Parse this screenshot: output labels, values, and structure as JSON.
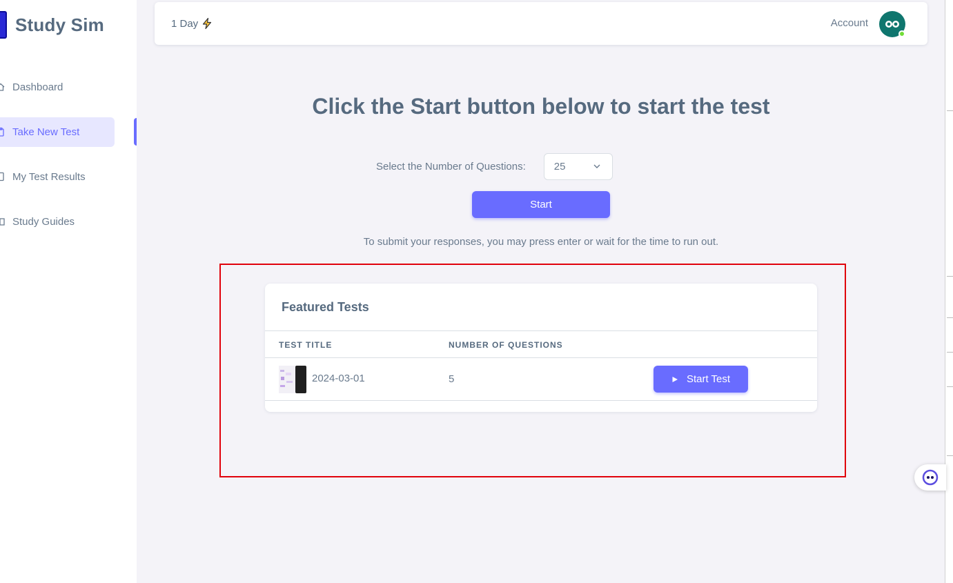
{
  "app": {
    "name": "Study Sim"
  },
  "sidebar": {
    "items": [
      {
        "label": "Dashboard",
        "icon": "home-icon"
      },
      {
        "label": "Take New Test",
        "icon": "clipboard-icon",
        "active": true
      },
      {
        "label": "My Test Results",
        "icon": "file-icon"
      },
      {
        "label": "Study Guides",
        "icon": "book-icon"
      }
    ]
  },
  "topbar": {
    "streak_label": "1 Day",
    "streak_icon": "lightning-icon",
    "account_label": "Account",
    "avatar_icon": "owl-avatar-icon"
  },
  "main": {
    "title": "Click the Start button below to start the test",
    "select_label": "Select the Number of Questions:",
    "select_value": "25",
    "start_button": "Start",
    "hint": "To submit your responses, you may press enter or wait for the time to run out."
  },
  "featured": {
    "title": "Featured Tests",
    "columns": [
      "Test Title",
      "Number of Questions"
    ],
    "rows": [
      {
        "title": "2024-03-01",
        "count": "5",
        "action": "Start Test"
      }
    ]
  },
  "colors": {
    "accent": "#696cff",
    "active_bg": "#e7e7ff",
    "highlight": "#e0000a",
    "avatar_bg": "#0f766e",
    "online": "#71dd37"
  }
}
